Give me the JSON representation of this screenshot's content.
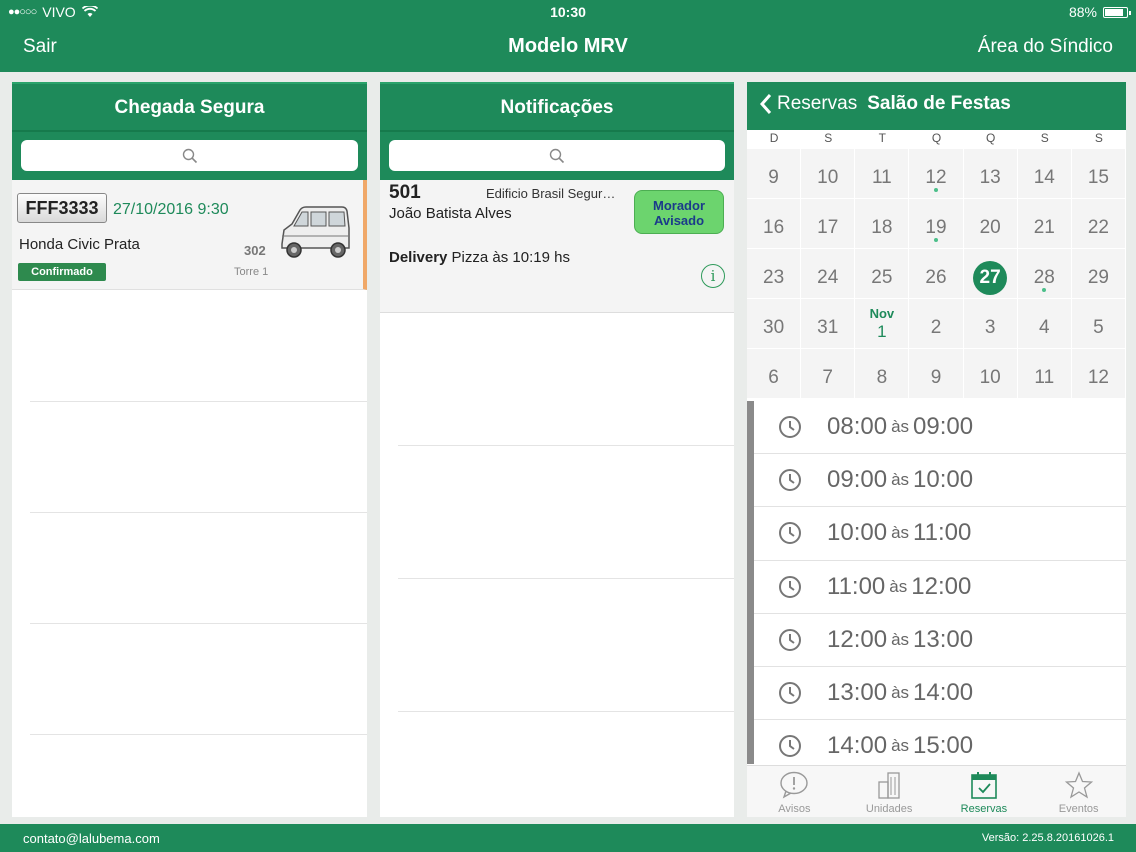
{
  "status_bar": {
    "carrier": "VIVO",
    "time": "10:30",
    "battery": "88%",
    "battery_level": 0.88
  },
  "nav": {
    "left": "Sair",
    "title": "Modelo MRV",
    "right": "Área do Síndico"
  },
  "arrivals": {
    "title": "Chegada Segura",
    "items": [
      {
        "plate": "FFF3333",
        "datetime": "27/10/2016 9:30",
        "vehicle": "Honda Civic Prata",
        "apartment": "302",
        "tower": "Torre 1",
        "status": "Confirmado"
      }
    ]
  },
  "notifications": {
    "title": "Notificações",
    "items": [
      {
        "apartment": "501",
        "building": "Edificio Brasil Segurança",
        "resident": "João Batista Alves",
        "action": "Morador Avisado",
        "type": "Delivery",
        "message": "Pizza às 10:19 hs"
      }
    ]
  },
  "reservations": {
    "back_label": "Reservas",
    "venue": "Salão de Festas",
    "weekdays": [
      "D",
      "S",
      "T",
      "Q",
      "Q",
      "S",
      "S"
    ],
    "weeks": [
      [
        "9",
        "10",
        "11",
        "12",
        "13",
        "14",
        "15"
      ],
      [
        "16",
        "17",
        "18",
        "19",
        "20",
        "21",
        "22"
      ],
      [
        "23",
        "24",
        "25",
        "26",
        "27",
        "28",
        "29"
      ],
      [
        "30",
        "31",
        "1",
        "2",
        "3",
        "4",
        "5"
      ],
      [
        "6",
        "7",
        "8",
        "9",
        "10",
        "11",
        "12"
      ]
    ],
    "month_marker": "Nov",
    "today": "27",
    "dotted_days": [
      "12",
      "19",
      "28"
    ],
    "time_slots": [
      {
        "start": "08:00",
        "sep": "às",
        "end": "09:00"
      },
      {
        "start": "09:00",
        "sep": "às",
        "end": "10:00"
      },
      {
        "start": "10:00",
        "sep": "às",
        "end": "11:00"
      },
      {
        "start": "11:00",
        "sep": "às",
        "end": "12:00"
      },
      {
        "start": "12:00",
        "sep": "às",
        "end": "13:00"
      },
      {
        "start": "13:00",
        "sep": "às",
        "end": "14:00"
      },
      {
        "start": "14:00",
        "sep": "às",
        "end": "15:00"
      }
    ],
    "tabs": [
      {
        "label": "Avisos",
        "icon": "exclamation-bubble-icon"
      },
      {
        "label": "Unidades",
        "icon": "buildings-icon"
      },
      {
        "label": "Reservas",
        "icon": "calendar-check-icon",
        "active": true
      },
      {
        "label": "Eventos",
        "icon": "star-icon"
      }
    ]
  },
  "footer": {
    "contact": "contato@lalubema.com",
    "version": "Versão: 2.25.8.20161026.1"
  },
  "colors": {
    "primary": "#1e8a5a",
    "accent_green": "#6cd46e",
    "pending_orange": "#f0a868"
  }
}
